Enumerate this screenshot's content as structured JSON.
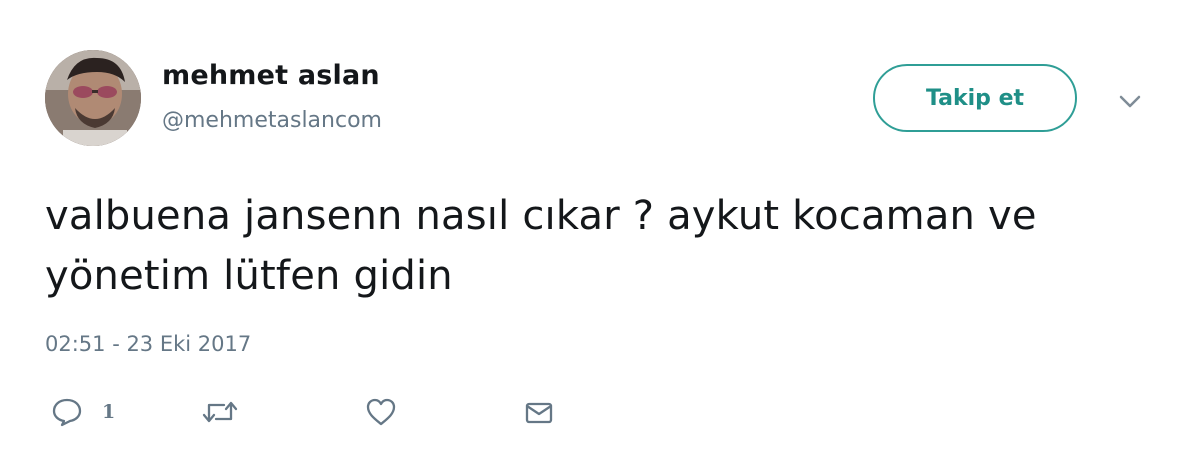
{
  "tweet": {
    "author": {
      "name": "mehmet aslan",
      "handle": "@mehmetaslancom"
    },
    "follow_label": "Takip et",
    "text": "valbuena jansenn nasıl cıkar ? aykut kocaman ve yönetim lütfen gidin",
    "timestamp": "02:51 - 23 Eki 2017",
    "actions": {
      "reply_count": "1"
    }
  },
  "icons": {
    "menu": "chevron-down-icon",
    "reply": "speech-bubble-icon",
    "retweet": "retweet-icon",
    "like": "heart-icon",
    "direct_message": "envelope-icon"
  },
  "colors": {
    "accent": "#1f8f87",
    "text_primary": "#14171a",
    "text_secondary": "#657786"
  }
}
